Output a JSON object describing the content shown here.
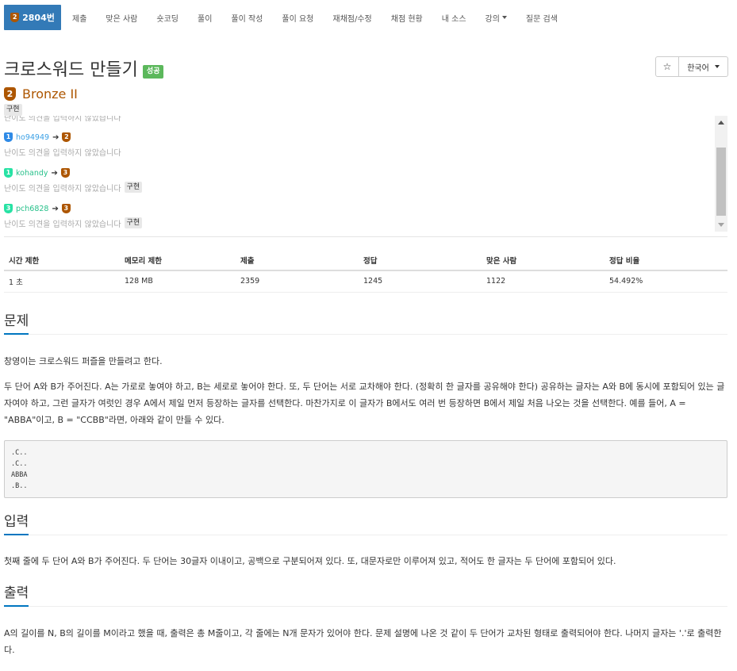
{
  "nav": {
    "active": {
      "tier_num": "2",
      "tier_color": "#ad5600",
      "label": "2804번"
    },
    "items": [
      "제출",
      "맞은 사람",
      "숏코딩",
      "풀이",
      "풀이 작성",
      "풀이 요청",
      "재채점/수정",
      "채점 현황",
      "내 소스",
      "강의",
      "질문 검색"
    ],
    "dropdown_item": "강의"
  },
  "problem": {
    "title": "크로스워드 만들기",
    "status_label": "성공",
    "star_icon": "☆",
    "language_button": "한국어",
    "tier_num": "2",
    "tier_name": "Bronze II",
    "tag": "구현"
  },
  "opinions": {
    "cut_top_text": "난이도 의견을 입력하지 않았습니다",
    "entries": [
      {
        "user_tier_num": "1",
        "user_tier_color": "#2e8ae6",
        "user": "ho94949",
        "arrow": "➔",
        "vote_tier_num": "2",
        "vote_tier_color": "#ad5600",
        "note": "난이도 의견을 입력하지 않았습니다",
        "tag": ""
      },
      {
        "user_tier_num": "1",
        "user_tier_color": "#27e2a4",
        "user": "kohandy",
        "arrow": "➔",
        "vote_tier_num": "3",
        "vote_tier_color": "#ad5600",
        "note": "난이도 의견을 입력하지 않았습니다",
        "tag": "구현"
      },
      {
        "user_tier_num": "3",
        "user_tier_color": "#27e2a4",
        "user": "pch6828",
        "arrow": "➔",
        "vote_tier_num": "3",
        "vote_tier_color": "#ad5600",
        "note": "난이도 의견을 입력하지 않았습니다",
        "tag": "구현"
      }
    ]
  },
  "stats": {
    "headers": [
      "시간 제한",
      "메모리 제한",
      "제출",
      "정답",
      "맞은 사람",
      "정답 비율"
    ],
    "row": [
      "1 초",
      "128 MB",
      "2359",
      "1245",
      "1122",
      "54.492%"
    ]
  },
  "sections": {
    "problem_heading": "문제",
    "problem_p1": "창영이는 크로스워드 퍼즐을 만들려고 한다.",
    "problem_p2": "두 단어 A와 B가 주어진다. A는 가로로 놓여야 하고, B는 세로로 놓어야 한다. 또, 두 단어는 서로 교차해야 한다. (정확히 한 글자를 공유해야 한다) 공유하는 글자는 A와 B에 동시에 포함되어 있는 글자여야 하고, 그런 글자가 여럿인 경우 A에서 제일 먼저 등장하는 글자를 선택한다. 마찬가지로 이 글자가 B에서도 여러 번 등장하면 B에서 제일 처음 나오는 것을 선택한다. 예를 들어, A = \"ABBA\"이고, B = \"CCBB\"라면, 아래와 같이 만들 수 있다.",
    "example_lines": [
      ".C..",
      ".C..",
      "ABBA",
      ".B.."
    ],
    "input_heading": "입력",
    "input_text": "첫째 줄에 두 단어 A와 B가 주어진다. 두 단어는 30글자 이내이고, 공백으로 구분되어져 있다. 또, 대문자로만 이루어져 있고, 적어도 한 글자는 두 단어에 포함되어 있다.",
    "output_heading": "출력",
    "output_text": "A의 길이를 N, B의 길이를 M이라고 했을 때, 출력은 총 M줄이고, 각 줄에는 N개 문자가 있어야 한다. 문제 설명에 나온 것 같이 두 단어가 교차된 형태로 출력되어야 한다. 나머지 글자는 '.'로 출력한다."
  }
}
